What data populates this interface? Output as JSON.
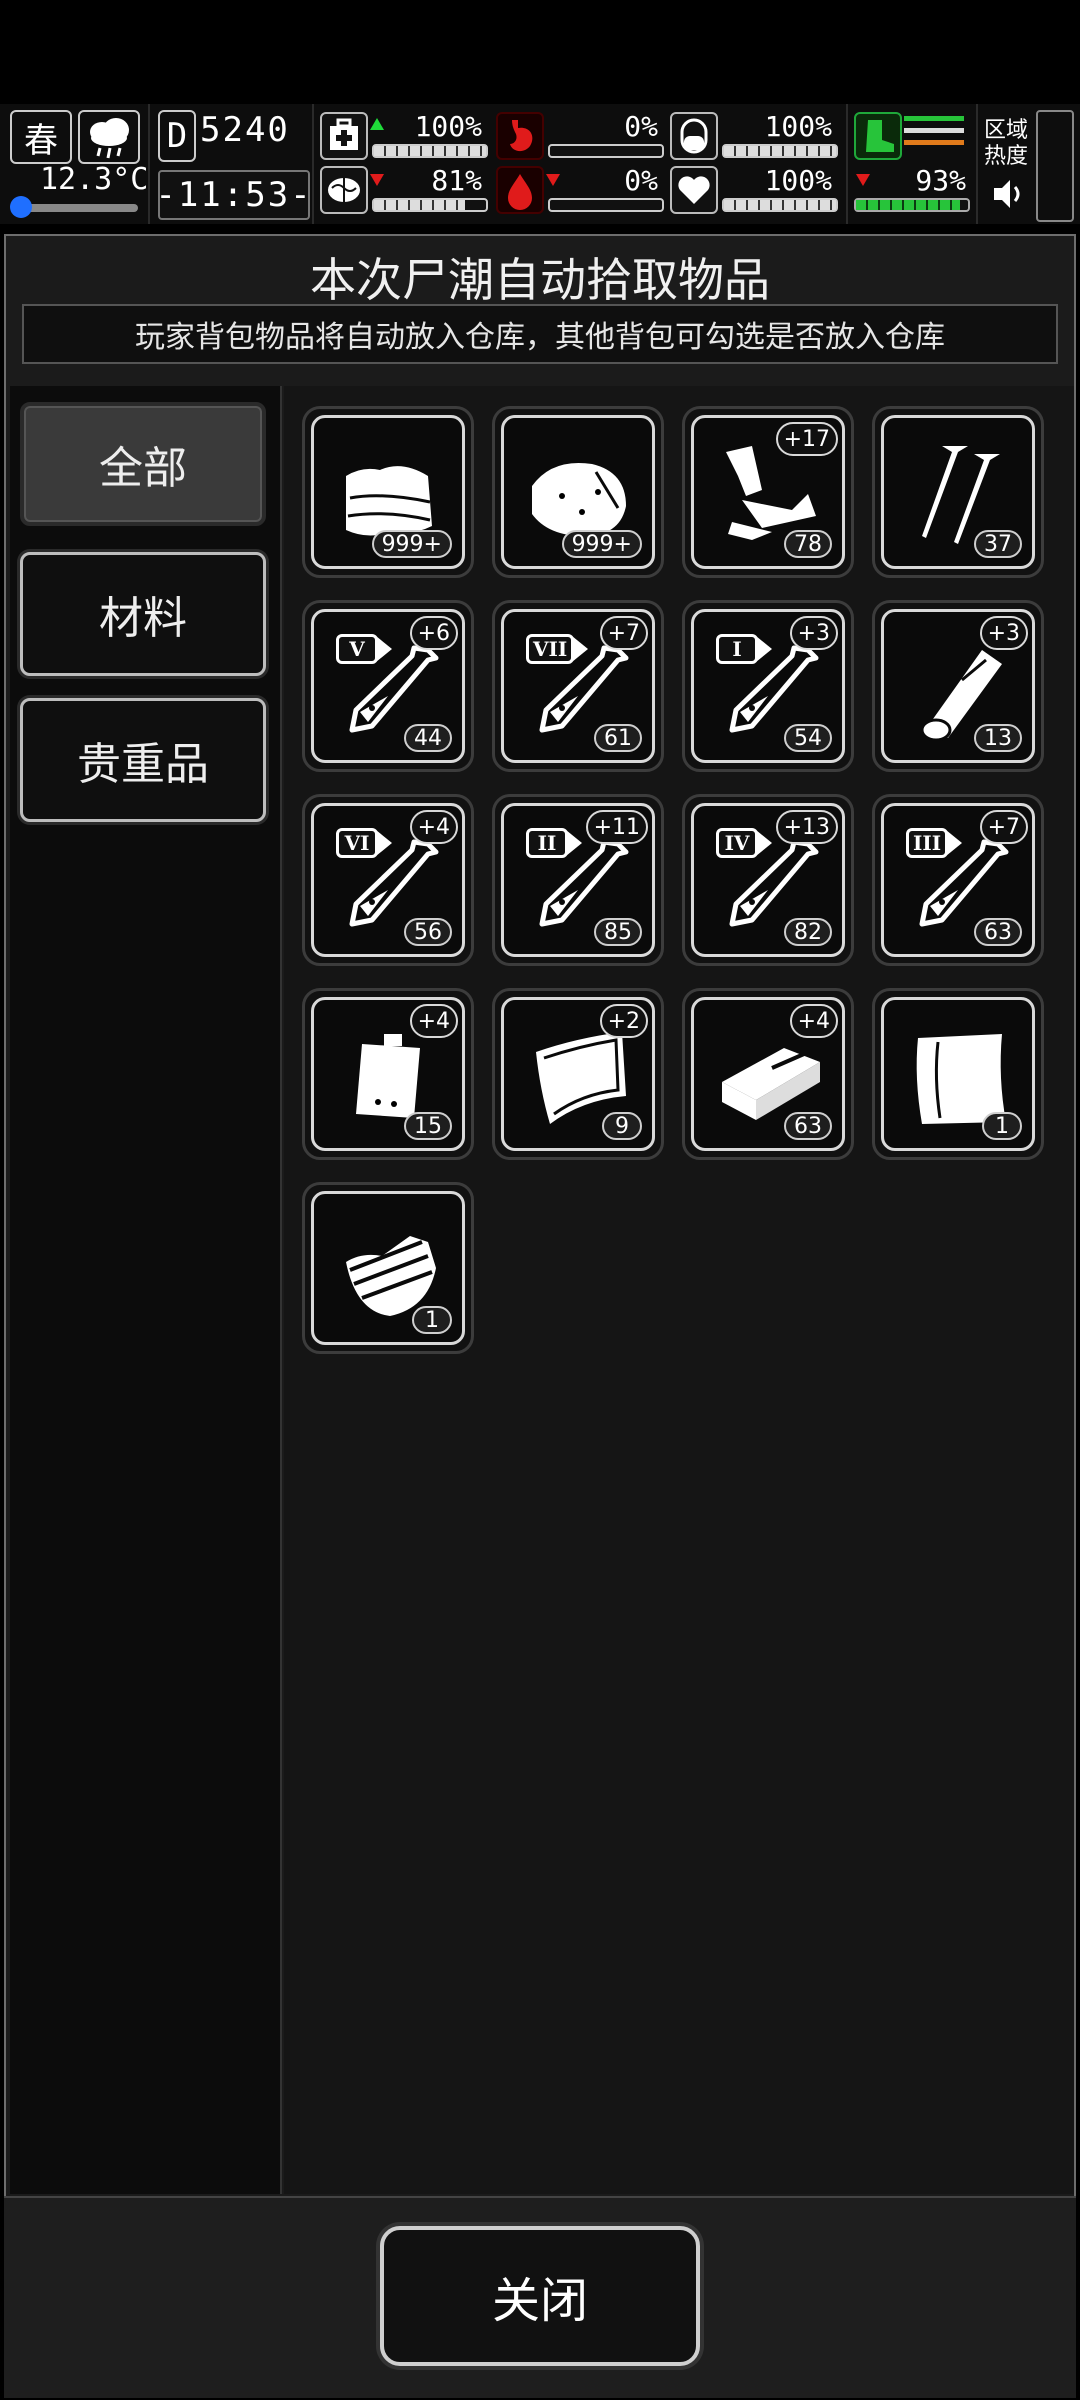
{
  "hud": {
    "season": "春",
    "season_icon": "feather-icon",
    "weather_icon": "rain-cloud-icon",
    "temperature": "12.3°C",
    "day_letter": "D",
    "day": "5240",
    "time": "-11:53-",
    "stats": [
      {
        "name": "health",
        "icon": "first-aid-icon",
        "value": "100%",
        "trend": "up",
        "fill": 1.0
      },
      {
        "name": "hunger",
        "icon": "stomach-icon",
        "value": "0%",
        "trend": "none",
        "fill": 0.0
      },
      {
        "name": "infection",
        "icon": "capsule-icon",
        "value": "100%",
        "trend": "none",
        "fill": 1.0
      },
      {
        "name": "sanity",
        "icon": "brain-icon",
        "value": "81%",
        "trend": "down",
        "fill": 0.81
      },
      {
        "name": "thirst",
        "icon": "blood-drop-icon",
        "value": "0%",
        "trend": "down",
        "fill": 0.0
      },
      {
        "name": "mood",
        "icon": "heart-icon",
        "value": "100%",
        "trend": "none",
        "fill": 1.0
      }
    ],
    "stamina": {
      "icon": "boot-icon",
      "value": "93%",
      "trend": "down",
      "fill": 0.93
    },
    "area_heat_label": "区域热度",
    "sound_icon": "speaker-icon",
    "colors": {
      "up": "#1fdc3a",
      "down": "#e01b1b",
      "stamina": "#27c43a"
    }
  },
  "dialog": {
    "title": "本次尸潮自动拾取物品",
    "notice": "玩家背包物品将自动放入仓库，其他背包可勾选是否放入仓库"
  },
  "tabs": [
    {
      "label": "全部",
      "active": true
    },
    {
      "label": "材料",
      "active": false
    },
    {
      "label": "贵重品",
      "active": false
    }
  ],
  "items": [
    {
      "icon": "cloth-icon",
      "count": "999+",
      "bonus": ""
    },
    {
      "icon": "raw-meat-icon",
      "count": "999+",
      "bonus": ""
    },
    {
      "icon": "scrap-parts-icon",
      "count": "78",
      "bonus": "+17"
    },
    {
      "icon": "nails-icon",
      "count": "37",
      "bonus": ""
    },
    {
      "icon": "syringe-icon",
      "tier": "V",
      "count": "44",
      "bonus": "+6"
    },
    {
      "icon": "syringe-icon",
      "tier": "VII",
      "count": "61",
      "bonus": "+7"
    },
    {
      "icon": "syringe-icon",
      "tier": "I",
      "count": "54",
      "bonus": "+3"
    },
    {
      "icon": "wood-log-icon",
      "count": "13",
      "bonus": "+3"
    },
    {
      "icon": "syringe-icon",
      "tier": "VI",
      "count": "56",
      "bonus": "+4"
    },
    {
      "icon": "syringe-icon",
      "tier": "II",
      "count": "85",
      "bonus": "+11"
    },
    {
      "icon": "syringe-icon",
      "tier": "IV",
      "count": "82",
      "bonus": "+13"
    },
    {
      "icon": "syringe-icon",
      "tier": "III",
      "count": "63",
      "bonus": "+7"
    },
    {
      "icon": "battery-pack-icon",
      "count": "15",
      "bonus": "+4"
    },
    {
      "icon": "leather-icon",
      "count": "9",
      "bonus": "+2"
    },
    {
      "icon": "brick-icon",
      "count": "63",
      "bonus": "+4"
    },
    {
      "icon": "paper-icon",
      "count": "1",
      "bonus": ""
    },
    {
      "icon": "planks-icon",
      "count": "1",
      "bonus": ""
    }
  ],
  "close_label": "关闭"
}
